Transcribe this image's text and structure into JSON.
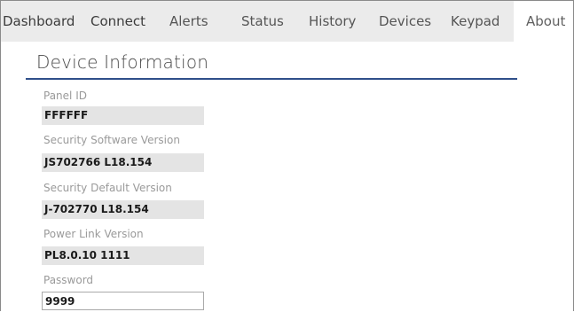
{
  "tabs": [
    {
      "label": "Dashboard"
    },
    {
      "label": "Connect"
    },
    {
      "label": "Alerts"
    },
    {
      "label": "Status"
    },
    {
      "label": "History"
    },
    {
      "label": "Devices"
    },
    {
      "label": "Keypad"
    },
    {
      "label": "About",
      "active": true
    }
  ],
  "device_info": {
    "title": "Device Information",
    "panel_id": {
      "label": "Panel ID",
      "value": "FFFFFF"
    },
    "security_software_version": {
      "label": "Security Software Version",
      "value": "JS702766 L18.154"
    },
    "security_default_version": {
      "label": "Security Default Version",
      "value": "J-702770 L18.154"
    },
    "power_link_version": {
      "label": "Power Link Version",
      "value": "PL8.0.10 1111"
    },
    "password": {
      "label": "Password",
      "value": "9999"
    }
  },
  "colors": {
    "tab_bar_bg": "#ebebeb",
    "title_rule": "#2f4f8a",
    "value_bg": "#e4e4e4"
  }
}
